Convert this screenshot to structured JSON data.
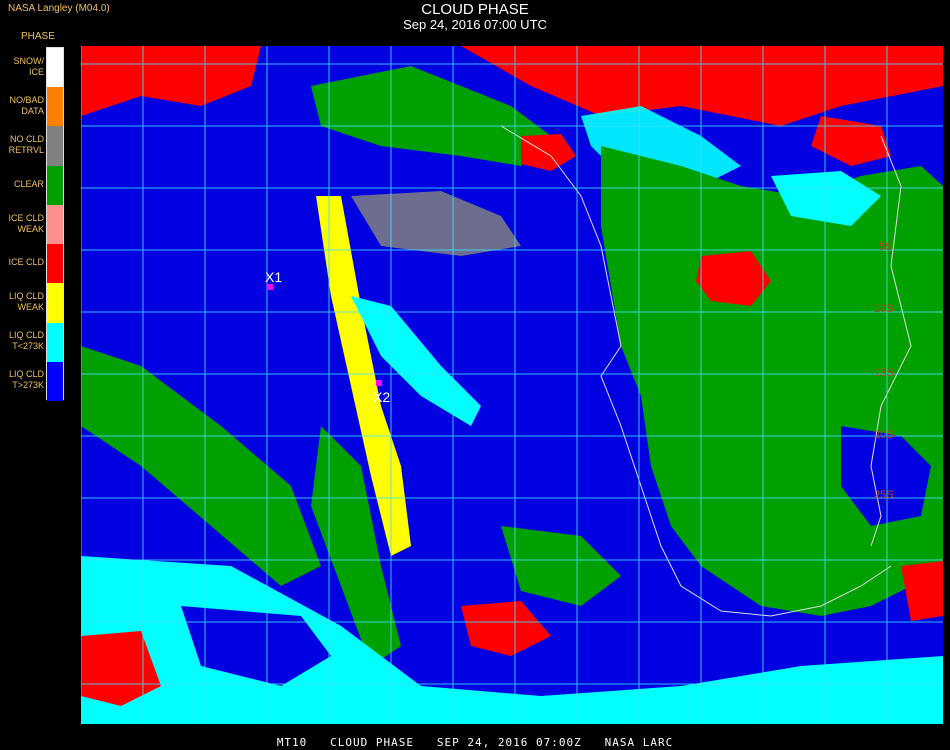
{
  "header": {
    "provider": "NASA Langley (M04.0)",
    "title": "CLOUD PHASE",
    "timestamp": "Sep 24, 2016 07:00 UTC"
  },
  "legend": {
    "heading": "PHASE",
    "items": [
      {
        "label": "SNOW/\nICE",
        "color": "#ffffff"
      },
      {
        "label": "NO/BAD\nDATA",
        "color": "#ff8000"
      },
      {
        "label": "NO CLD\nRETRVL",
        "color": "#808080"
      },
      {
        "label": "CLEAR",
        "color": "#00a000"
      },
      {
        "label": "ICE CLD\nWEAK",
        "color": "#ff9090"
      },
      {
        "label": "ICE CLD",
        "color": "#ff0000"
      },
      {
        "label": "LIQ CLD\nWEAK",
        "color": "#ffff00"
      },
      {
        "label": "LIQ CLD\nT<273K",
        "color": "#00ffff"
      },
      {
        "label": "LIQ CLD\nT>273K",
        "color": "#0000ff"
      }
    ]
  },
  "markers": [
    {
      "label": "X1"
    },
    {
      "label": "X2"
    }
  ],
  "lat_labels": [
    "5S",
    "10S",
    "15S",
    "20S",
    "25S"
  ],
  "footer": "MT10   CLOUD PHASE   SEP 24, 2016 07:00Z   NASA LARC",
  "colors": {
    "ocean_liq_warm": "#0000e0",
    "clear_land": "#00a000",
    "ice_cloud": "#ff0000",
    "liq_cold": "#00ffff",
    "liq_weak": "#ffff00",
    "no_retrieval": "#808080",
    "grid": "#40e0ff",
    "coastline": "#e0e0e0",
    "marker": "#ff00ff"
  }
}
